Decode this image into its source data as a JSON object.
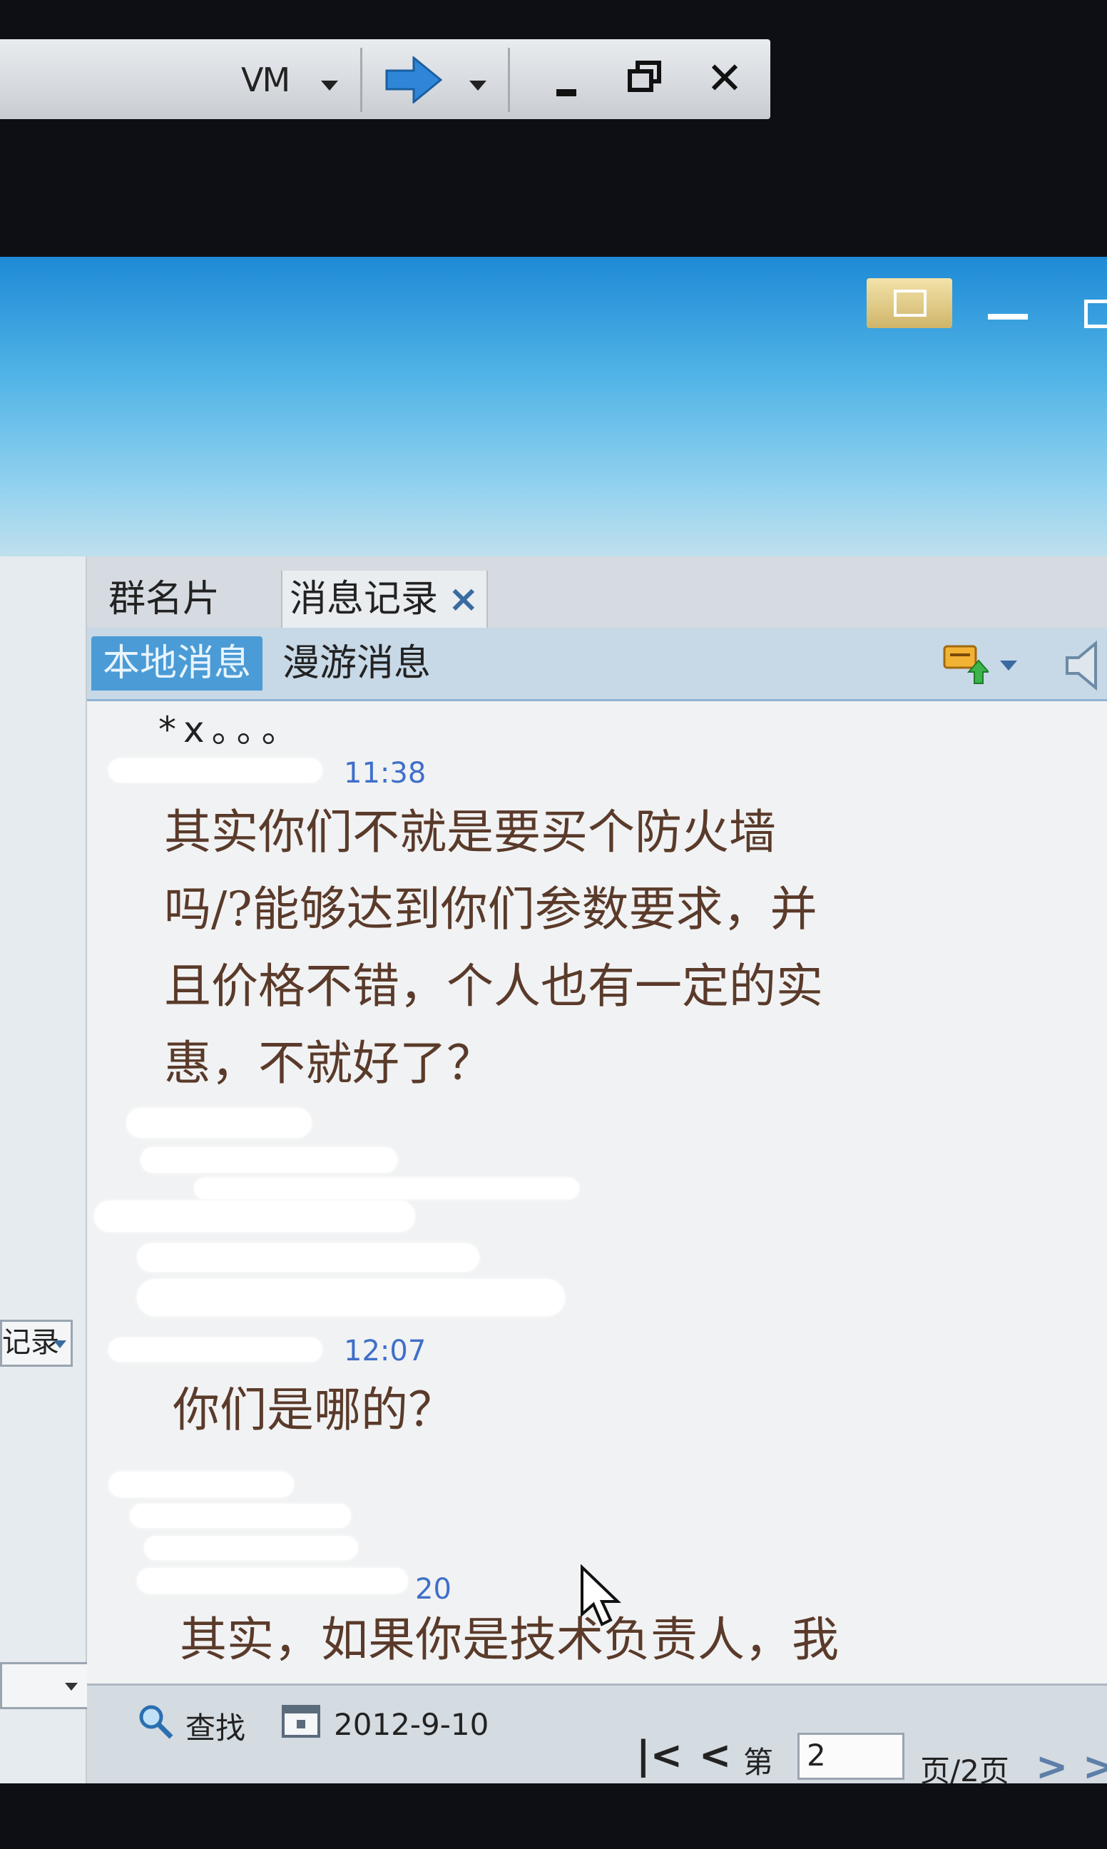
{
  "vm_bar": {
    "label": "VM",
    "icons": [
      "dropdown-caret",
      "forward-arrow-icon",
      "minimize-icon",
      "restore-icon",
      "close-icon"
    ]
  },
  "tabs": [
    {
      "label": "群名片"
    },
    {
      "label": "消息记录",
      "close": "×"
    }
  ],
  "subtabs": [
    {
      "label": "本地消息"
    },
    {
      "label": "漫游消息"
    }
  ],
  "chat": {
    "fragment": "*x。。。",
    "messages": [
      {
        "time": "11:38",
        "text_lines": [
          "其实你们不就是要买个防火墙",
          "吗/?能够达到你们参数要求，并",
          "且价格不错，个人也有一定的实",
          "惠，不就好了？"
        ]
      },
      {
        "time": "12:07",
        "text_lines": [
          "你们是哪的？"
        ]
      },
      {
        "time": "20",
        "text_lines": [
          "其实，如果你是技术负责人，我"
        ]
      }
    ]
  },
  "left_pane": {
    "dropdown_label": "记录"
  },
  "bottom_bar": {
    "search_label": "查找",
    "date": "2012-9-10",
    "page_prefix": "第",
    "page_value": "2",
    "page_suffix": "页/2页",
    "first_label": "|<",
    "prev_label": "<",
    "next_label": ">",
    "last_label": ">"
  },
  "colors": {
    "title_blue": "#1e8ad6",
    "selected_tab": "#4b9bd6",
    "timestamp": "#3f6fc9",
    "message_text": "#5a3a2a"
  }
}
